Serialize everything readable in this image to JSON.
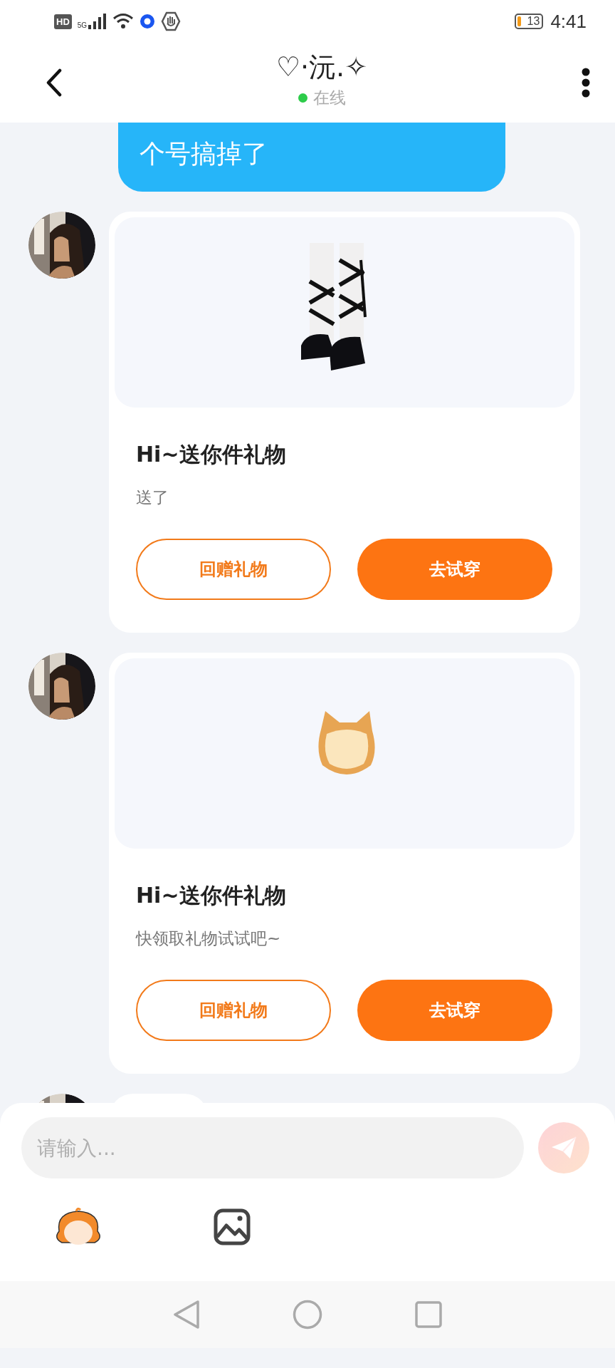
{
  "status_bar": {
    "hd": "HD",
    "network": "5G",
    "battery": "13",
    "time": "4:41"
  },
  "header": {
    "title": "♡·沅.✧",
    "status": "在线",
    "online": true
  },
  "messages": [
    {
      "kind": "text",
      "outgoing": true,
      "text": "个号搞掉了"
    },
    {
      "kind": "gift",
      "outgoing": false,
      "title": "Hi~送你件礼物",
      "subtitle": "送了",
      "buttons": [
        {
          "label": "回赠礼物",
          "kind": "outline"
        },
        {
          "label": "去试穿",
          "kind": "filled"
        }
      ]
    },
    {
      "kind": "gift",
      "outgoing": false,
      "title": "Hi~送你件礼物",
      "subtitle": "快领取礼物试试吧~",
      "buttons": [
        {
          "label": "回赠礼物",
          "kind": "outline"
        },
        {
          "label": "去试穿",
          "kind": "filled"
        }
      ]
    },
    {
      "kind": "partial",
      "outgoing": false
    }
  ],
  "composer": {
    "placeholder": "请输入...",
    "send_disabled": true
  }
}
